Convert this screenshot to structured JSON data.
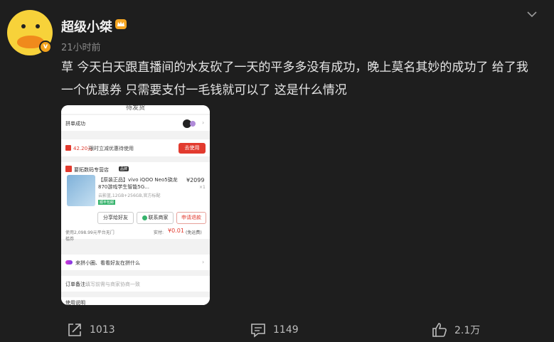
{
  "post": {
    "author": "超级小桀",
    "timestamp": "21小时前",
    "text": "草 今天白天跟直播间的水友砍了一天的平多多没有成功，晚上莫名其妙的成功了 给了我一个优惠券 只需要支付一毛钱就可以了 这是什么情况"
  },
  "screenshot": {
    "top_title": "待发货",
    "group_status": "拼单成功",
    "coupon_amount": "42.20元",
    "coupon_text": "限时立减优惠待使用",
    "use_button": "去使用",
    "store_name": "要拓数码专营店",
    "store_tag": "品牌",
    "product_title": "【原装正品】vivo iQOO Neo5骁龙870游戏学生智能5G...",
    "product_tag": "预售",
    "price": "¥2099",
    "quantity": "×1",
    "spec": "云影蓝,12GB+256GB,官方标配",
    "shipping_tag": "顺丰包邮",
    "btn_share": "分享给好友",
    "btn_contact": "联系商家",
    "btn_refund": "申请退款",
    "paid_line1": "使用2,098.99元平台无门",
    "paid_line2": "槛券",
    "real_pay_label": "实付:",
    "real_pay_value": "¥0.01",
    "real_pay_suffix": "(免运费)",
    "invite_text": "来拼小圈、看看好友在拼什么",
    "note_label": "订单备注:",
    "note_placeholder": "填写前需与商家协商一致",
    "usage_label": "使用说明"
  },
  "actions": {
    "share_count": "1013",
    "comment_count": "1149",
    "like_count": "2.1万"
  },
  "icons": {
    "verify": "verified-badge-icon",
    "crown": "crown-icon",
    "chevron": "chevron-down-icon",
    "share": "share-icon",
    "comment": "comment-icon",
    "like": "thumbs-up-icon"
  }
}
